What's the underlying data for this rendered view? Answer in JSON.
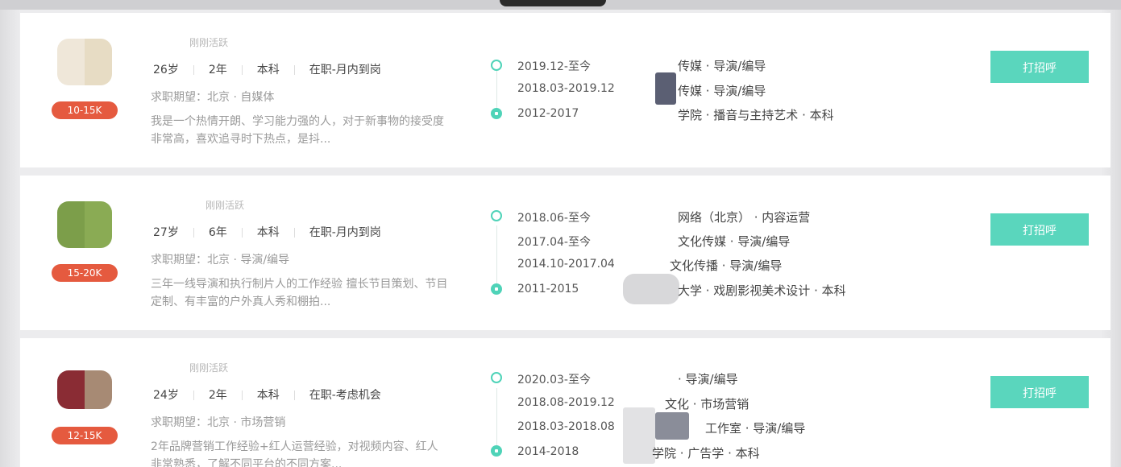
{
  "candidates": [
    {
      "active": "刚刚活跃",
      "age": "26岁",
      "experience": "2年",
      "education": "本科",
      "status": "在职-月内到岗",
      "salary": "10-15K",
      "expect": "求职期望：北京 · 自媒体",
      "description": "我是一个热情开朗、学习能力强的人，对于新事物的接受度非常高，喜欢追寻时下热点，是抖...",
      "timeline": [
        {
          "date": "2019.12-至今",
          "text": "传媒 · 导演/编导"
        },
        {
          "date": "2018.03-2019.12",
          "text": "传媒 · 导演/编导"
        },
        {
          "date": "2012-2017",
          "text": "学院 · 播音与主持艺术 · 本科"
        }
      ],
      "button": "打招呼",
      "avatar_colors": [
        "#efe7d9",
        "#e7dcc4"
      ]
    },
    {
      "active": "刚刚活跃",
      "age": "27岁",
      "experience": "6年",
      "education": "本科",
      "status": "在职-月内到岗",
      "salary": "15-20K",
      "expect": "求职期望：北京 · 导演/编导",
      "description": "三年一线导演和执行制片人的工作经验 擅长节目策划、节目定制、有丰富的户外真人秀和棚拍...",
      "timeline": [
        {
          "date": "2018.06-至今",
          "text": "网络（北京） · 内容运营"
        },
        {
          "date": "2017.04-至今",
          "text": "文化传媒 · 导演/编导"
        },
        {
          "date": "2014.10-2017.04",
          "text": "文化传播 · 导演/编导"
        },
        {
          "date": "2011-2015",
          "text": "大学 · 戏剧影视美术设计 · 本科"
        }
      ],
      "button": "打招呼",
      "avatar_colors": [
        "#7c9e4a",
        "#8aab54"
      ]
    },
    {
      "active": "刚刚活跃",
      "age": "24岁",
      "experience": "2年",
      "education": "本科",
      "status": "在职-考虑机会",
      "salary": "12-15K",
      "expect": "求职期望：北京 · 市场营销",
      "description": "2年品牌营销工作经验+红人运营经验，对视频内容、红人非常熟悉，了解不同平台的不同方案...",
      "timeline": [
        {
          "date": "2020.03-至今",
          "text": "· 导演/编导"
        },
        {
          "date": "2018.08-2019.12",
          "text": "文化 · 市场营销"
        },
        {
          "date": "2018.03-2018.08",
          "text": "工作室 · 导演/编导"
        },
        {
          "date": "2014-2018",
          "text": "学院 · 广告学 · 本科"
        }
      ],
      "button": "打招呼",
      "avatar_colors": [
        "#8a2c34",
        "#a78a74"
      ]
    }
  ],
  "accent_color": "#5ad6bd",
  "salary_color": "#e55a3f"
}
